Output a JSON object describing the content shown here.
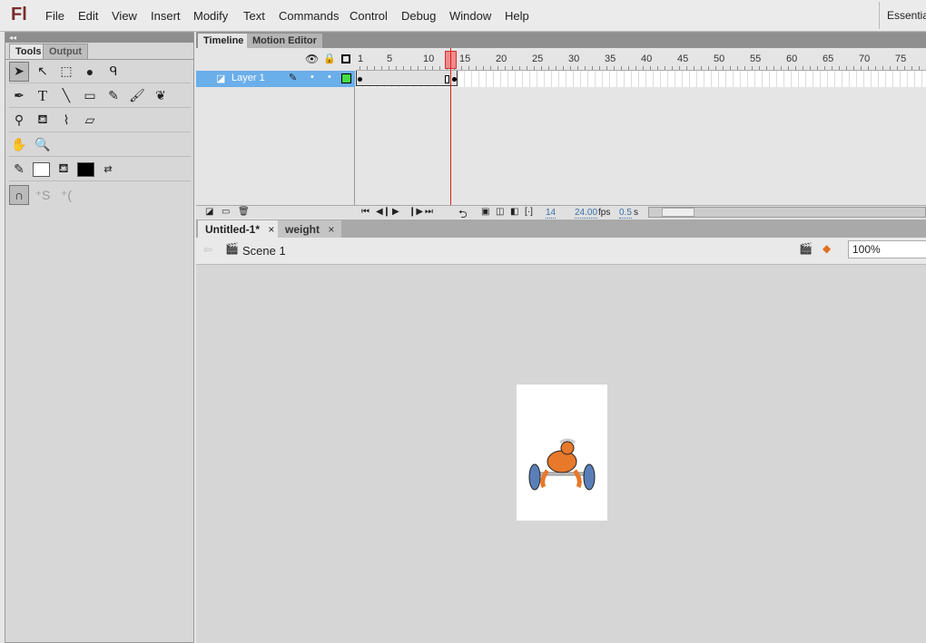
{
  "app": {
    "logo": "Fl",
    "workspace": "Essentials"
  },
  "menu": [
    "File",
    "Edit",
    "View",
    "Insert",
    "Modify",
    "Text",
    "Commands",
    "Control",
    "Debug",
    "Window",
    "Help"
  ],
  "left_panel": {
    "tabs": [
      "Tools",
      "Output"
    ],
    "collapse": "◂◂"
  },
  "timeline": {
    "tabs": [
      "Timeline",
      "Motion Editor"
    ],
    "frame_numbers": [
      1,
      5,
      10,
      15,
      20,
      25,
      30,
      35,
      40,
      45,
      50,
      55,
      60,
      65,
      70,
      75
    ],
    "layers": [
      {
        "name": "Layer 1",
        "color": "#44dd44"
      }
    ],
    "current_frame": "14",
    "fps": "24.00",
    "fps_unit": "fps",
    "time": "0.5",
    "time_unit": "s",
    "playhead_frame": 14
  },
  "documents": {
    "tabs": [
      "Untitled-1*",
      "weight"
    ],
    "close": "×"
  },
  "scene": {
    "name": "Scene 1",
    "zoom": "100%"
  },
  "colors": {
    "accent": "#6aaeea",
    "playhead": "#dd2222",
    "stroke": "#000000",
    "fill": "#000000"
  }
}
